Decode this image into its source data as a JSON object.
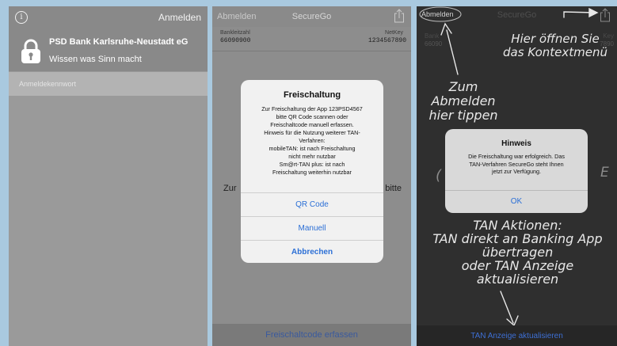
{
  "screen1": {
    "info_icon": "info-circle-icon",
    "login_label": "Anmelden",
    "bank_name": "PSD Bank Karlsruhe-Neustadt eG",
    "slogan": "Wissen was Sinn macht",
    "password_placeholder": "Anmeldekennwort"
  },
  "screen2": {
    "nav": {
      "logout": "Abmelden",
      "title": "SecureGo"
    },
    "bank_code_label": "Bankleitzahl",
    "bank_code": "66090900",
    "netkey_label": "NetKey",
    "netkey": "1234567890",
    "background_left": "Zur",
    "background_right": "bitte",
    "dialog": {
      "title": "Freischaltung",
      "lines": [
        "Zur Freischaltung der App 123PSD4567",
        "bitte QR Code scannen oder",
        "Freischaltcode manuell erfassen.",
        "Hinweis für die Nutzung weiterer TAN-",
        "Verfahren:",
        "mobileTAN: ist nach Freischaltung",
        "nicht mehr nutzbar",
        "Sm@rt-TAN plus: ist nach",
        "Freischaltung weiterhin nutzbar"
      ],
      "buttons": [
        "QR Code",
        "Manuell",
        "Abbrechen"
      ]
    },
    "footer": "Freischaltcode erfassen"
  },
  "screen3": {
    "nav": {
      "logout": "Abmelden",
      "title": "SecureGo"
    },
    "ghost_bank_label": "Bank",
    "ghost_bank_code": "66090",
    "ghost_right": "Key",
    "ghost_right_value": "7890",
    "annotations": {
      "context_menu": [
        "Hier öffnen Sie",
        "das Kontextmenü"
      ],
      "logout_hint": [
        "Zum",
        "Abmelden",
        "hier tippen"
      ],
      "tan_actions": [
        "TAN Aktionen:",
        "TAN direkt an Banking App",
        "übertragen",
        "oder TAN Anzeige",
        "aktualisieren"
      ]
    },
    "ghost_side_left": "(",
    "ghost_side_right": "E",
    "dialog": {
      "title": "Hinweis",
      "lines": [
        "Die Freischaltung war erfolgreich. Das",
        "TAN-Verfahren SecureGo steht Ihnen",
        "jetzt zur Verfügung."
      ],
      "button": "OK"
    },
    "footer": "TAN Anzeige aktualisieren"
  }
}
